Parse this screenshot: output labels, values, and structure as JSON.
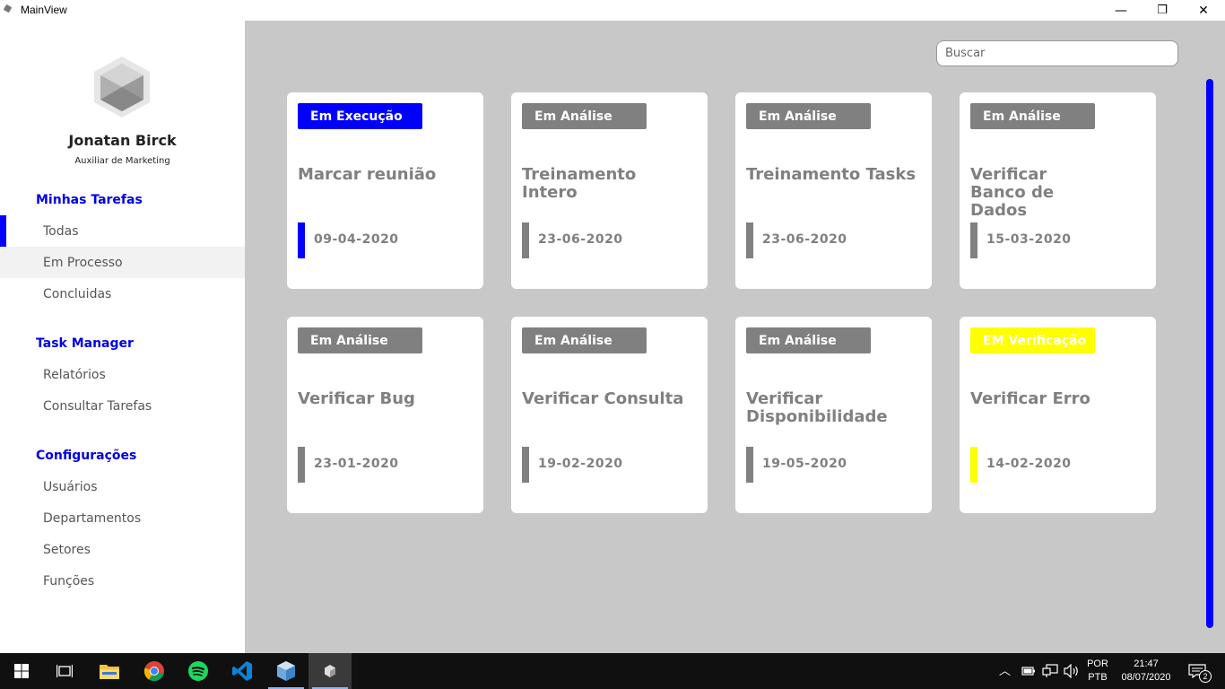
{
  "window": {
    "title": "MainView",
    "minimize_glyph": "—",
    "maximize_glyph": "❐",
    "close_glyph": "✕"
  },
  "user": {
    "name": "Jonatan Birck",
    "role": "Auxiliar de Marketing"
  },
  "sidebar": {
    "sections": [
      {
        "title": "Minhas Tarefas",
        "items": [
          "Todas",
          "Em Processo",
          "Concluidas"
        ]
      },
      {
        "title": "Task Manager",
        "items": [
          "Relatórios",
          "Consultar Tarefas"
        ]
      },
      {
        "title": "Configurações",
        "items": [
          "Usuários",
          "Departamentos",
          "Setores",
          "Funções"
        ]
      }
    ],
    "selected_item": "Todas",
    "hovered_item": "Em Processo"
  },
  "search": {
    "placeholder": "Buscar",
    "value": ""
  },
  "cards": [
    {
      "status": "Em Execução",
      "status_color": "#0000ff",
      "status_text_color": "#ffffff",
      "title": "Marcar reunião",
      "date": "09-04-2020"
    },
    {
      "status": "Em Análise",
      "status_color": "#808080",
      "status_text_color": "#ffffff",
      "title": "Treinamento Intero",
      "date": "23-06-2020"
    },
    {
      "status": "Em Análise",
      "status_color": "#808080",
      "status_text_color": "#ffffff",
      "title": "Treinamento Tasks",
      "date": "23-06-2020"
    },
    {
      "status": "Em Análise",
      "status_color": "#808080",
      "status_text_color": "#ffffff",
      "title": "Verificar Banco de Dados",
      "date": "15-03-2020"
    },
    {
      "status": "Em Análise",
      "status_color": "#808080",
      "status_text_color": "#ffffff",
      "title": "Verificar Bug",
      "date": "23-01-2020"
    },
    {
      "status": "Em Análise",
      "status_color": "#808080",
      "status_text_color": "#ffffff",
      "title": "Verificar Consulta",
      "date": "19-02-2020"
    },
    {
      "status": "Em Análise",
      "status_color": "#808080",
      "status_text_color": "#ffffff",
      "title": "Verificar Disponibilidade",
      "date": "19-05-2020"
    },
    {
      "status": "EM Verificação",
      "status_color": "#ffff00",
      "status_text_color": "#ffffff",
      "title": "Verificar Erro",
      "date": "14-02-2020"
    }
  ],
  "colors": {
    "accent": "#0000ff",
    "content_bg": "#c8c8c8",
    "sidebar_bg": "#ffffff",
    "card_text": "#808080"
  },
  "taskbar": {
    "apps": [
      "windows-start",
      "task-view",
      "file-explorer",
      "chrome",
      "spotify",
      "vscode",
      "virtualbox",
      "mainview-app"
    ],
    "tray": {
      "language": "POR",
      "layout": "PTB",
      "time": "21:47",
      "date": "08/07/2020",
      "notifications": "2"
    }
  }
}
